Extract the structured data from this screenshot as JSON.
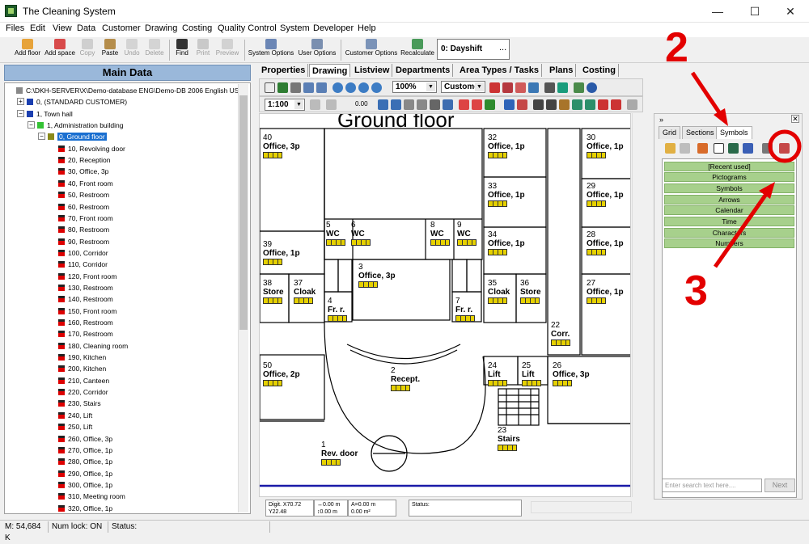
{
  "window": {
    "title": "The Cleaning System",
    "minimize": "—",
    "maximize": "☐",
    "close": "✕"
  },
  "menu": [
    "Files",
    "Edit",
    "View",
    "Data",
    "Customer",
    "Drawing",
    "Costing",
    "Quality Control",
    "System",
    "Developer",
    "Help"
  ],
  "toolbar": {
    "buttons": [
      {
        "label": "Add floor",
        "disabled": false
      },
      {
        "label": "Add space",
        "disabled": false
      },
      {
        "label": "Copy",
        "disabled": true
      },
      {
        "label": "Paste",
        "disabled": false
      },
      {
        "label": "Undo",
        "disabled": true
      },
      {
        "label": "Delete",
        "disabled": true
      },
      {
        "label": "Find",
        "disabled": false
      },
      {
        "label": "Print",
        "disabled": true
      },
      {
        "label": "Preview",
        "disabled": true
      },
      {
        "label": "System Options",
        "disabled": false
      },
      {
        "label": "User Options",
        "disabled": false
      },
      {
        "label": "Customer Options",
        "disabled": false
      },
      {
        "label": "Recalculate",
        "disabled": false
      }
    ],
    "shift": "0: Dayshift",
    "shift_button": "..."
  },
  "left_panel": {
    "header": "Main Data",
    "tree": [
      {
        "label": "C:\\DKH-SERVER\\X\\Demo-database ENG\\Demo-DB 2006 English US",
        "level": 0,
        "icon": "database"
      },
      {
        "label": "0, (STANDARD CUSTOMER)",
        "level": 1,
        "icon": "customer",
        "expander": "+"
      },
      {
        "label": "1, Town hall",
        "level": 1,
        "icon": "customer",
        "expander": "−"
      },
      {
        "label": "1, Administration building",
        "level": 2,
        "icon": "building",
        "expander": "−"
      },
      {
        "label": "0, Ground floor",
        "level": 3,
        "icon": "floor",
        "expander": "−",
        "selected": true
      },
      {
        "label": "10, Revolving door",
        "level": 4,
        "icon": "room"
      },
      {
        "label": "20, Reception",
        "level": 4,
        "icon": "room"
      },
      {
        "label": "30, Office, 3p",
        "level": 4,
        "icon": "room"
      },
      {
        "label": "40, Front room",
        "level": 4,
        "icon": "room"
      },
      {
        "label": "50, Restroom",
        "level": 4,
        "icon": "room"
      },
      {
        "label": "60, Restroom",
        "level": 4,
        "icon": "room"
      },
      {
        "label": "70, Front room",
        "level": 4,
        "icon": "room"
      },
      {
        "label": "80, Restroom",
        "level": 4,
        "icon": "room"
      },
      {
        "label": "90, Restroom",
        "level": 4,
        "icon": "room"
      },
      {
        "label": "100, Corridor",
        "level": 4,
        "icon": "room"
      },
      {
        "label": "110, Corridor",
        "level": 4,
        "icon": "room"
      },
      {
        "label": "120, Front room",
        "level": 4,
        "icon": "room"
      },
      {
        "label": "130, Restroom",
        "level": 4,
        "icon": "room"
      },
      {
        "label": "140, Restroom",
        "level": 4,
        "icon": "room"
      },
      {
        "label": "150, Front room",
        "level": 4,
        "icon": "room"
      },
      {
        "label": "160, Restroom",
        "level": 4,
        "icon": "room"
      },
      {
        "label": "170, Restroom",
        "level": 4,
        "icon": "room"
      },
      {
        "label": "180, Cleaning room",
        "level": 4,
        "icon": "room"
      },
      {
        "label": "190, Kitchen",
        "level": 4,
        "icon": "room"
      },
      {
        "label": "200, Kitchen",
        "level": 4,
        "icon": "room"
      },
      {
        "label": "210, Canteen",
        "level": 4,
        "icon": "room"
      },
      {
        "label": "220, Corridor",
        "level": 4,
        "icon": "room"
      },
      {
        "label": "230, Stairs",
        "level": 4,
        "icon": "room"
      },
      {
        "label": "240, Lift",
        "level": 4,
        "icon": "room"
      },
      {
        "label": "250, Lift",
        "level": 4,
        "icon": "room"
      },
      {
        "label": "260, Office, 3p",
        "level": 4,
        "icon": "room"
      },
      {
        "label": "270, Office, 1p",
        "level": 4,
        "icon": "room"
      },
      {
        "label": "280, Office, 1p",
        "level": 4,
        "icon": "room"
      },
      {
        "label": "290, Office, 1p",
        "level": 4,
        "icon": "room"
      },
      {
        "label": "300, Office, 1p",
        "level": 4,
        "icon": "room"
      },
      {
        "label": "310, Meeting room",
        "level": 4,
        "icon": "room"
      },
      {
        "label": "320, Office, 1p",
        "level": 4,
        "icon": "room"
      }
    ]
  },
  "tabs": [
    {
      "label": "Properties",
      "active": false
    },
    {
      "label": "Drawing",
      "active": true
    },
    {
      "label": "Listview",
      "active": false
    },
    {
      "label": "Departments",
      "active": false
    },
    {
      "label": "Area Types / Tasks",
      "active": false
    },
    {
      "label": "Plans",
      "active": false
    },
    {
      "label": "Costing",
      "active": false
    }
  ],
  "drawing_toolbar": {
    "zoom": "100%",
    "custom": "Custome",
    "scale": "1:100",
    "value": "0.00"
  },
  "floorplan": {
    "title": "Ground floor",
    "rooms": [
      {
        "num": "40",
        "name": "Office, 3p"
      },
      {
        "num": "39",
        "name": "Office, 1p"
      },
      {
        "num": "38",
        "name": "Store"
      },
      {
        "num": "37",
        "name": "Cloak"
      },
      {
        "num": "5",
        "name": "WC"
      },
      {
        "num": "6",
        "name": "WC"
      },
      {
        "num": "8",
        "name": "WC"
      },
      {
        "num": "9",
        "name": "WC"
      },
      {
        "num": "3",
        "name": "Office, 3p"
      },
      {
        "num": "4",
        "name": "Fr. r."
      },
      {
        "num": "7",
        "name": "Fr. r."
      },
      {
        "num": "32",
        "name": "Office, 1p"
      },
      {
        "num": "33",
        "name": "Office, 1p"
      },
      {
        "num": "34",
        "name": "Office, 1p"
      },
      {
        "num": "35",
        "name": "Cloak"
      },
      {
        "num": "36",
        "name": "Store"
      },
      {
        "num": "30",
        "name": "Office, 1p"
      },
      {
        "num": "29",
        "name": "Office, 1p"
      },
      {
        "num": "28",
        "name": "Office, 1p"
      },
      {
        "num": "27",
        "name": "Office, 1p"
      },
      {
        "num": "22",
        "name": "Corr."
      },
      {
        "num": "50",
        "name": "Office, 2p"
      },
      {
        "num": "2",
        "name": "Recept."
      },
      {
        "num": "24",
        "name": "Lift"
      },
      {
        "num": "25",
        "name": "Lift"
      },
      {
        "num": "26",
        "name": "Office, 3p"
      },
      {
        "num": "23",
        "name": "Stairs"
      },
      {
        "num": "1",
        "name": "Rev. door"
      }
    ]
  },
  "coords": {
    "digit_label": "Digit.",
    "x": "X70.72",
    "y": "Y22.48",
    "dx": "↔0.00 m",
    "dy": "↕0.00 m",
    "da": "A=0.00 m",
    "area": "0.00 m²",
    "status": "Status:"
  },
  "right_panel": {
    "tabs": [
      {
        "label": "Grid",
        "active": false
      },
      {
        "label": "Sections",
        "active": false
      },
      {
        "label": "Symbols",
        "active": true
      }
    ],
    "categories": [
      "[Recent used]",
      "Pictograms",
      "Symbols",
      "Arrows",
      "Calendar",
      "Time",
      "Characters",
      "Numbers"
    ],
    "search_placeholder": "Enter search text here....",
    "next": "Next"
  },
  "statusbar": {
    "memory": "M: 54,684 K",
    "numlock": "Num lock: ON",
    "status": "Status:"
  },
  "annotations": {
    "two": "2",
    "three": "3"
  },
  "colors": {
    "accent_red": "#e30000",
    "header_blue": "#9ab8da",
    "symbol_green": "#a7d08c"
  }
}
